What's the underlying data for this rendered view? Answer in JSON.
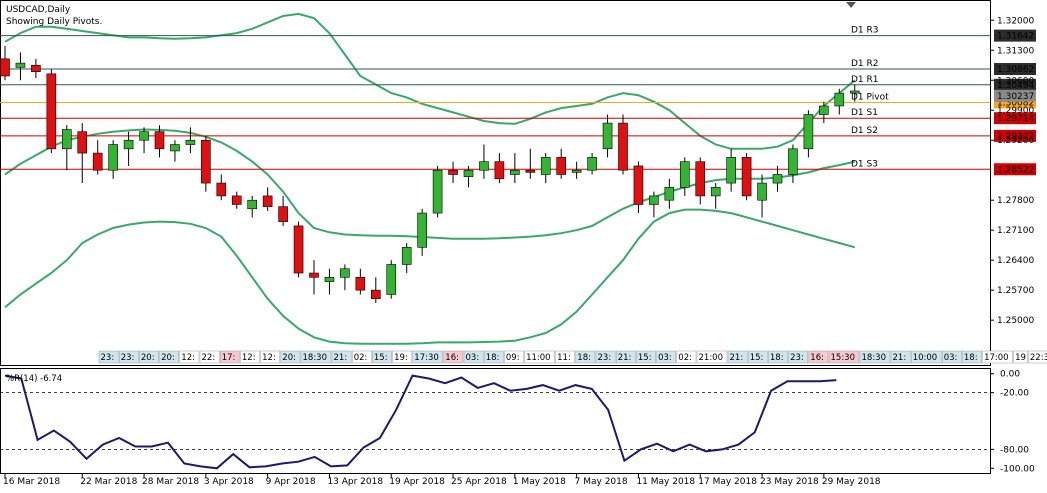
{
  "header": {
    "symbol": "USDCAD,Daily",
    "indicator_note": "Showing Daily Pivots."
  },
  "colors": {
    "bull": "#33b533",
    "bear": "#e01010",
    "bands": "#3aa86a",
    "pivot": "#f5a623",
    "resistance": "#2f5a4f",
    "support": "#cc0000",
    "wpr": "#1a1a6e",
    "label_bg": "#2b2b2b"
  },
  "pivots": [
    {
      "name": "D1 R3",
      "value": 1.31642,
      "label": "1.31642",
      "kind": "resistance"
    },
    {
      "name": "D1 R2",
      "value": 1.30862,
      "label": "1.30862",
      "kind": "resistance"
    },
    {
      "name": "D1 R1",
      "value": 1.30494,
      "label": "1.30494",
      "kind": "resistance"
    },
    {
      "name": "D1 Pivot",
      "value": 1.30082,
      "label": "1.30082",
      "kind": "pivot"
    },
    {
      "name": "D1 S1",
      "value": 1.29714,
      "label": "1.29714",
      "kind": "support"
    },
    {
      "name": "D1 S2",
      "value": 1.29302,
      "label": "1.29302",
      "kind": "support"
    },
    {
      "name": "D1 S3",
      "value": 1.28522,
      "label": "1.28522",
      "kind": "support"
    }
  ],
  "price_label": {
    "value": 1.30237,
    "label": "1.30237"
  },
  "chart_data": [
    {
      "type": "candlestick",
      "title": "USDCAD,Daily",
      "ylim": [
        1.2435,
        1.3245
      ],
      "yticks": [
        {
          "value": 1.32,
          "label": "1.32000"
        },
        {
          "value": 1.313,
          "label": "1.31300"
        },
        {
          "value": 1.306,
          "label": "1.30600"
        },
        {
          "value": 1.299,
          "label": "1.29900"
        },
        {
          "value": 1.292,
          "label": "1.29200"
        },
        {
          "value": 1.278,
          "label": "1.27800"
        },
        {
          "value": 1.271,
          "label": "1.27100"
        },
        {
          "value": 1.264,
          "label": "1.26400"
        },
        {
          "value": 1.257,
          "label": "1.25700"
        },
        {
          "value": 1.25,
          "label": "1.25000"
        }
      ],
      "candles": [
        [
          1.311,
          1.314,
          1.306,
          1.307
        ],
        [
          1.309,
          1.3125,
          1.306,
          1.31
        ],
        [
          1.3095,
          1.311,
          1.3065,
          1.308
        ],
        [
          1.3075,
          1.3085,
          1.289,
          1.29
        ],
        [
          1.29,
          1.2955,
          1.285,
          1.2945
        ],
        [
          1.294,
          1.296,
          1.282,
          1.289
        ],
        [
          1.289,
          1.292,
          1.284,
          1.285
        ],
        [
          1.285,
          1.292,
          1.283,
          1.291
        ],
        [
          1.29,
          1.294,
          1.286,
          1.292
        ],
        [
          1.292,
          1.295,
          1.289,
          1.294
        ],
        [
          1.294,
          1.2955,
          1.288,
          1.29
        ],
        [
          1.2895,
          1.292,
          1.287,
          1.291
        ],
        [
          1.291,
          1.295,
          1.289,
          1.292
        ],
        [
          1.292,
          1.293,
          1.28,
          1.282
        ],
        [
          1.282,
          1.284,
          1.278,
          1.279
        ],
        [
          1.279,
          1.28,
          1.276,
          1.277
        ],
        [
          1.276,
          1.279,
          1.274,
          1.278
        ],
        [
          1.279,
          1.281,
          1.2755,
          1.2765
        ],
        [
          1.2765,
          1.279,
          1.272,
          1.273
        ],
        [
          1.272,
          1.273,
          1.26,
          1.261
        ],
        [
          1.261,
          1.264,
          1.256,
          1.26
        ],
        [
          1.259,
          1.262,
          1.256,
          1.26
        ],
        [
          1.26,
          1.263,
          1.257,
          1.262
        ],
        [
          1.26,
          1.262,
          1.256,
          1.257
        ],
        [
          1.257,
          1.26,
          1.254,
          1.255
        ],
        [
          1.256,
          1.264,
          1.255,
          1.263
        ],
        [
          1.263,
          1.268,
          1.261,
          1.267
        ],
        [
          1.267,
          1.276,
          1.265,
          1.275
        ],
        [
          1.275,
          1.286,
          1.274,
          1.285
        ],
        [
          1.285,
          1.287,
          1.282,
          1.284
        ],
        [
          1.2835,
          1.286,
          1.281,
          1.285
        ],
        [
          1.285,
          1.291,
          1.283,
          1.287
        ],
        [
          1.287,
          1.289,
          1.282,
          1.283
        ],
        [
          1.284,
          1.289,
          1.282,
          1.285
        ],
        [
          1.285,
          1.29,
          1.283,
          1.2845
        ],
        [
          1.284,
          1.289,
          1.282,
          1.288
        ],
        [
          1.288,
          1.29,
          1.283,
          1.284
        ],
        [
          1.2845,
          1.287,
          1.283,
          1.285
        ],
        [
          1.285,
          1.289,
          1.284,
          1.288
        ],
        [
          1.29,
          1.298,
          1.288,
          1.296
        ],
        [
          1.296,
          1.298,
          1.284,
          1.285
        ],
        [
          1.286,
          1.287,
          1.275,
          1.277
        ],
        [
          1.277,
          1.28,
          1.274,
          1.279
        ],
        [
          1.278,
          1.283,
          1.276,
          1.281
        ],
        [
          1.281,
          1.288,
          1.279,
          1.287
        ],
        [
          1.287,
          1.288,
          1.277,
          1.279
        ],
        [
          1.279,
          1.282,
          1.276,
          1.281
        ],
        [
          1.282,
          1.29,
          1.28,
          1.288
        ],
        [
          1.288,
          1.289,
          1.278,
          1.279
        ],
        [
          1.278,
          1.284,
          1.274,
          1.282
        ],
        [
          1.282,
          1.286,
          1.28,
          1.284
        ],
        [
          1.284,
          1.291,
          1.282,
          1.29
        ],
        [
          1.29,
          1.299,
          1.288,
          1.298
        ],
        [
          1.298,
          1.301,
          1.296,
          1.3
        ],
        [
          1.3,
          1.304,
          1.298,
          1.303
        ],
        [
          1.303,
          1.305,
          1.301,
          1.3035
        ]
      ],
      "bands": {
        "upper": [
          1.315,
          1.317,
          1.3185,
          1.3185,
          1.318,
          1.3175,
          1.317,
          1.3165,
          1.316,
          1.316,
          1.3158,
          1.3157,
          1.3158,
          1.316,
          1.3165,
          1.317,
          1.318,
          1.3195,
          1.321,
          1.3215,
          1.3205,
          1.317,
          1.312,
          1.307,
          1.305,
          1.303,
          1.302,
          1.3005,
          1.2995,
          1.2985,
          1.2975,
          1.2965,
          1.296,
          1.2958,
          1.297,
          1.2985,
          1.2995,
          1.3,
          1.3005,
          1.302,
          1.303,
          1.3025,
          1.301,
          1.299,
          1.296,
          1.293,
          1.291,
          1.29,
          1.29,
          1.29,
          1.2905,
          1.292,
          1.296,
          1.3,
          1.303,
          1.306
        ],
        "middle": [
          1.284,
          1.2865,
          1.2885,
          1.2905,
          1.292,
          1.2928,
          1.2935,
          1.294,
          1.2943,
          1.2945,
          1.2944,
          1.2942,
          1.2937,
          1.2928,
          1.2915,
          1.2895,
          1.287,
          1.284,
          1.28,
          1.275,
          1.2715,
          1.2705,
          1.27,
          1.2698,
          1.2697,
          1.2697,
          1.2696,
          1.2694,
          1.2692,
          1.269,
          1.269,
          1.269,
          1.2691,
          1.2693,
          1.2695,
          1.2698,
          1.2703,
          1.271,
          1.272,
          1.274,
          1.276,
          1.2775,
          1.2787,
          1.28,
          1.281,
          1.282,
          1.2827,
          1.283,
          1.283,
          1.283,
          1.2833,
          1.2838,
          1.2845,
          1.2855,
          1.2862,
          1.287
        ],
        "lower": [
          1.253,
          1.256,
          1.2585,
          1.261,
          1.264,
          1.268,
          1.27,
          1.2715,
          1.2723,
          1.2728,
          1.273,
          1.2729,
          1.2725,
          1.2715,
          1.2695,
          1.265,
          1.26,
          1.255,
          1.251,
          1.248,
          1.246,
          1.245,
          1.2446,
          1.2445,
          1.2445,
          1.2445,
          1.2445,
          1.2446,
          1.2448,
          1.2448,
          1.2448,
          1.2449,
          1.245,
          1.2452,
          1.246,
          1.247,
          1.249,
          1.252,
          1.256,
          1.26,
          1.264,
          1.269,
          1.273,
          1.275,
          1.2758,
          1.2758,
          1.2755,
          1.275,
          1.274,
          1.273,
          1.272,
          1.271,
          1.27,
          1.269,
          1.268,
          1.267
        ]
      },
      "x_labels": [
        {
          "i": 0,
          "label": "16 Mar 2018"
        },
        {
          "i": 5,
          "label": "22 Mar 2018"
        },
        {
          "i": 9,
          "label": "28 Mar 2018"
        },
        {
          "i": 13,
          "label": "3 Apr 2018"
        },
        {
          "i": 17,
          "label": "9 Apr 2018"
        },
        {
          "i": 21,
          "label": "13 Apr 2018"
        },
        {
          "i": 25,
          "label": "19 Apr 2018"
        },
        {
          "i": 29,
          "label": "25 Apr 2018"
        },
        {
          "i": 33,
          "label": "1 May 2018"
        },
        {
          "i": 37,
          "label": "7 May 2018"
        },
        {
          "i": 41,
          "label": "11 May 2018"
        },
        {
          "i": 45,
          "label": "17 May 2018"
        },
        {
          "i": 49,
          "label": "23 May 2018"
        },
        {
          "i": 53,
          "label": "29 May 2018"
        }
      ],
      "time_strip": [
        "23:",
        "23:",
        "20:",
        "20:",
        "12:",
        "22:",
        "17:",
        "12:",
        "12:",
        "20:",
        "18:30",
        "21:",
        "02:",
        "15:",
        "19:",
        "17:30",
        "16:",
        "03:",
        "18:",
        "09:",
        "11:00",
        "11:",
        "18:",
        "23:",
        "21:",
        "15:",
        "03:",
        "02:",
        "21:00",
        "21:",
        "15:",
        "18:",
        "23:",
        "16:",
        "15:30",
        "18:30",
        "21:",
        "10:00",
        "03:",
        "18:",
        "17:00",
        "19",
        "22:30"
      ]
    },
    {
      "type": "line",
      "title": "%R(14) -6.74",
      "ylim": [
        -105,
        5
      ],
      "yticks": [
        {
          "value": 0,
          "label": "0.00"
        },
        {
          "value": -20,
          "label": "-20.00"
        },
        {
          "value": -80,
          "label": "-80.00"
        },
        {
          "value": -100,
          "label": "-100.00"
        }
      ],
      "levels": [
        -20,
        -80
      ],
      "series": [
        {
          "values": [
            -2,
            -5,
            -70,
            -60,
            -72,
            -90,
            -75,
            -68,
            -77,
            -77,
            -73,
            -95,
            -98,
            -100,
            -85,
            -99,
            -98,
            -95,
            -93,
            -88,
            -98,
            -97,
            -78,
            -68,
            -38,
            -2,
            -5,
            -10,
            -4,
            -15,
            -10,
            -18,
            -16,
            -12,
            -18,
            -12,
            -16,
            -38,
            -92,
            -80,
            -74,
            -82,
            -75,
            -82,
            -80,
            -75,
            -62,
            -18,
            -8,
            -8,
            -8,
            -6.74
          ]
        }
      ]
    }
  ]
}
